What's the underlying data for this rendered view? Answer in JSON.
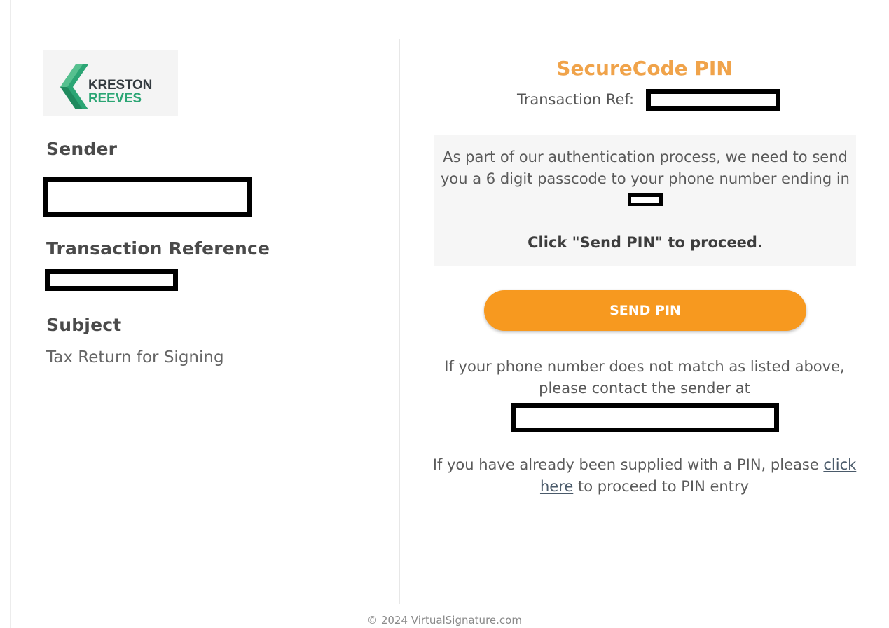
{
  "brand": {
    "line1": "KRESTON",
    "line2": "REEVES",
    "colors": {
      "dark": "#333a3f",
      "green": "#2ba574"
    }
  },
  "left": {
    "sender_label": "Sender",
    "transaction_reference_label": "Transaction Reference",
    "subject_label": "Subject",
    "subject_value": "Tax Return for Signing"
  },
  "right": {
    "title": "SecureCode PIN",
    "transaction_ref_label": "Transaction Ref:",
    "info_text_1": "As part of our authentication process, we need to send you a 6 digit passcode to your phone number ending in",
    "info_proceed": "Click \"Send PIN\" to proceed.",
    "send_button_label": "SEND PIN",
    "mismatch_text": "If your phone number does not match as listed above, please contact the sender at",
    "supplied_prefix": "If you have already been supplied with a PIN, please",
    "supplied_link": "click here",
    "supplied_suffix": "to proceed to PIN entry"
  },
  "footer": {
    "copyright": "© 2024 VirtualSignature.com"
  },
  "colors": {
    "accent_orange": "#f7991f",
    "title_orange": "#f0a34a"
  }
}
